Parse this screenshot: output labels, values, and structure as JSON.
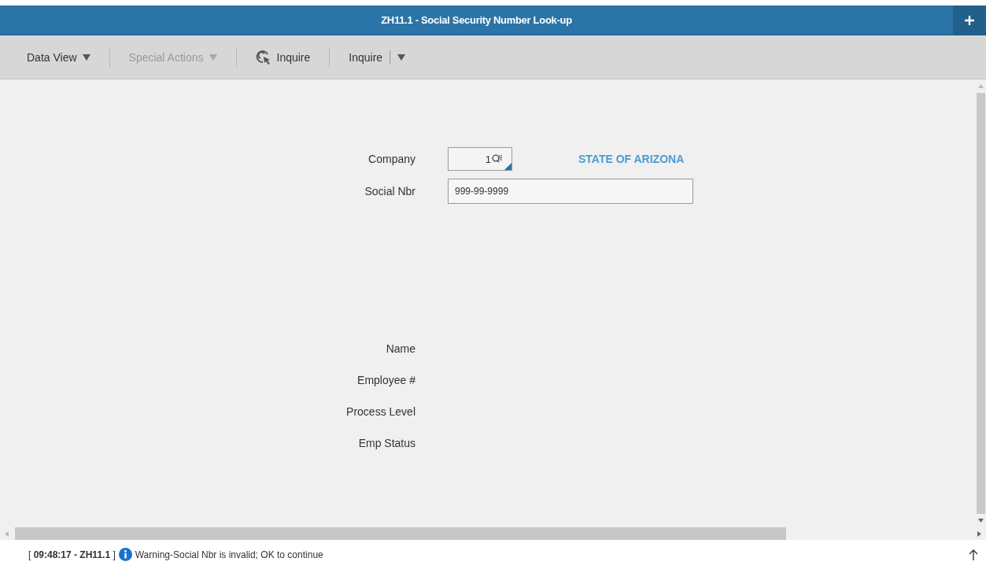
{
  "window": {
    "title": "ZH11.1 - Social Security Number Look-up"
  },
  "toolbar": [
    {
      "kind": "menu",
      "label": "Data View",
      "disabled": false
    },
    {
      "kind": "menu",
      "label": "Special Actions",
      "disabled": true
    },
    {
      "kind": "action",
      "label": "Inquire",
      "disabled": false
    },
    {
      "kind": "split",
      "label": "Inquire",
      "disabled": false
    }
  ],
  "form": {
    "company": {
      "label": "Company",
      "value": "1",
      "description": "STATE OF ARIZONA"
    },
    "social_nbr": {
      "label": "Social Nbr",
      "value": "999-99-9999"
    },
    "info_labels": [
      "Name",
      "Employee #",
      "Process Level",
      "Emp Status"
    ]
  },
  "status_bar": {
    "message_prefix": "[ **09:48:17 - ZH11.1** ]",
    "message": "Warning-Social Nbr is invalid; OK to continue"
  }
}
